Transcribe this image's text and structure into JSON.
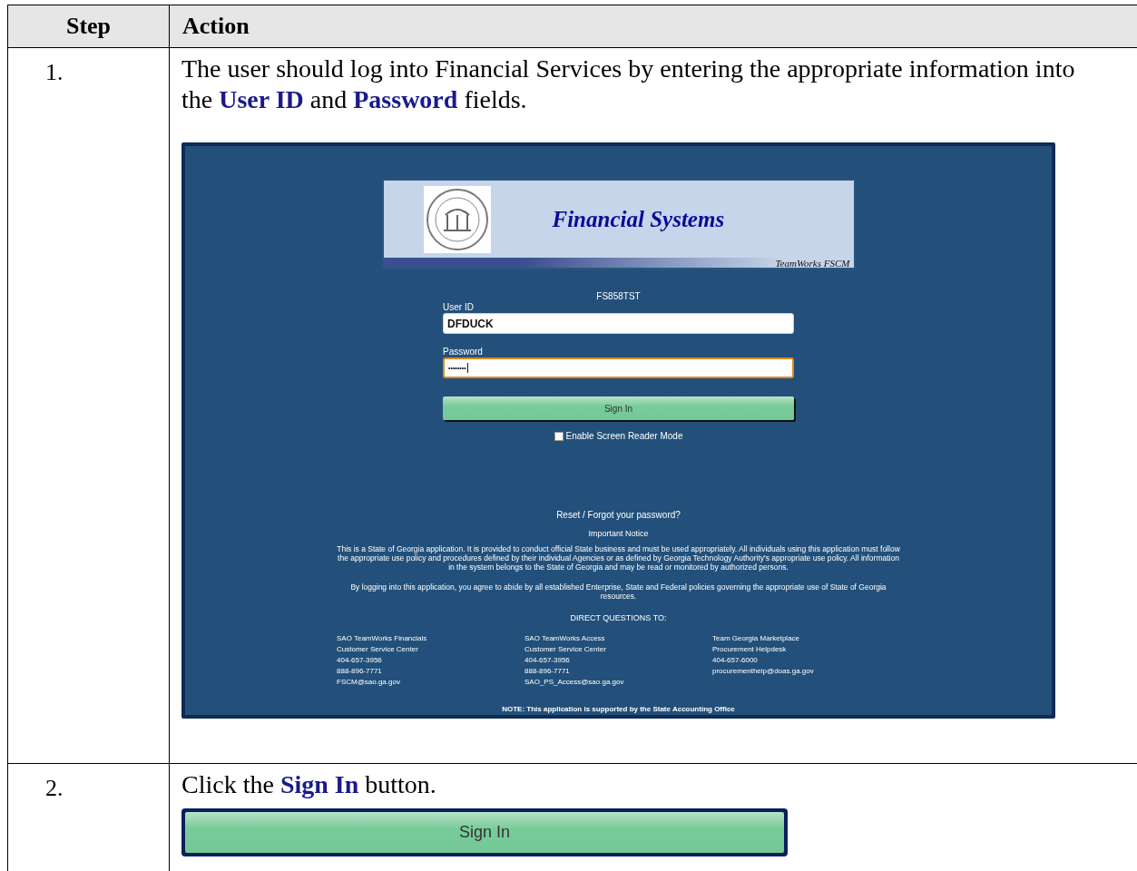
{
  "table": {
    "columns": [
      "Step",
      "Action"
    ],
    "rows": [
      {
        "step": "1.",
        "instruction": "The user should log into Financial Services by entering the appropriate information into the **User ID** and **Password** fields.",
        "kind": "login_screen"
      },
      {
        "step": "2.",
        "instruction": "Click the **Sign In** button.",
        "kind": "button_crop"
      }
    ]
  },
  "login_screen": {
    "banner": {
      "title": "Financial Systems",
      "subtitle": "TeamWorks FSCM"
    },
    "database": "FS858TST",
    "user_id": {
      "label": "User ID",
      "value": "DFDUCK"
    },
    "password": {
      "label": "Password",
      "value": "••••••••",
      "focused": true
    },
    "sign_in_button": "Sign In",
    "screen_reader": {
      "label": "Enable Screen Reader Mode",
      "checked": false
    },
    "reset_link": "Reset / Forgot your password?",
    "notice_title": "Important Notice",
    "notice_paragraphs": [
      "This is a State of Georgia application. It is provided to conduct official State business and must be used appropriately. All individuals using this application must follow the appropriate use policy and procedures defined by their individual Agencies or as defined by Georgia Technology Authority's appropriate use policy. All information in the system belongs to the State of Georgia and may be read or monitored by authorized persons.",
      "By logging into this application, you agree to abide by all established Enterprise, State and Federal policies governing the appropriate use of State of Georgia resources."
    ],
    "direct_questions_title": "DIRECT QUESTIONS TO:",
    "contacts": [
      {
        "lines": [
          "SAO TeamWorks Financials",
          "Customer Service Center",
          "404-657-3956",
          "888-896-7771",
          "FSCM@sao.ga.gov"
        ]
      },
      {
        "lines": [
          "SAO TeamWorks Access",
          "Customer Service Center",
          "404-657-3956",
          "888-896-7771",
          "SAO_PS_Access@sao.ga.gov"
        ]
      },
      {
        "lines": [
          "Team Georgia Marketplace",
          "Procurement Helpdesk",
          "404-657-6000",
          "procurementhelp@doas.ga.gov"
        ]
      }
    ],
    "note": "NOTE: This application is supported by the State Accounting Office"
  },
  "button_crop": {
    "label": "Sign In"
  }
}
